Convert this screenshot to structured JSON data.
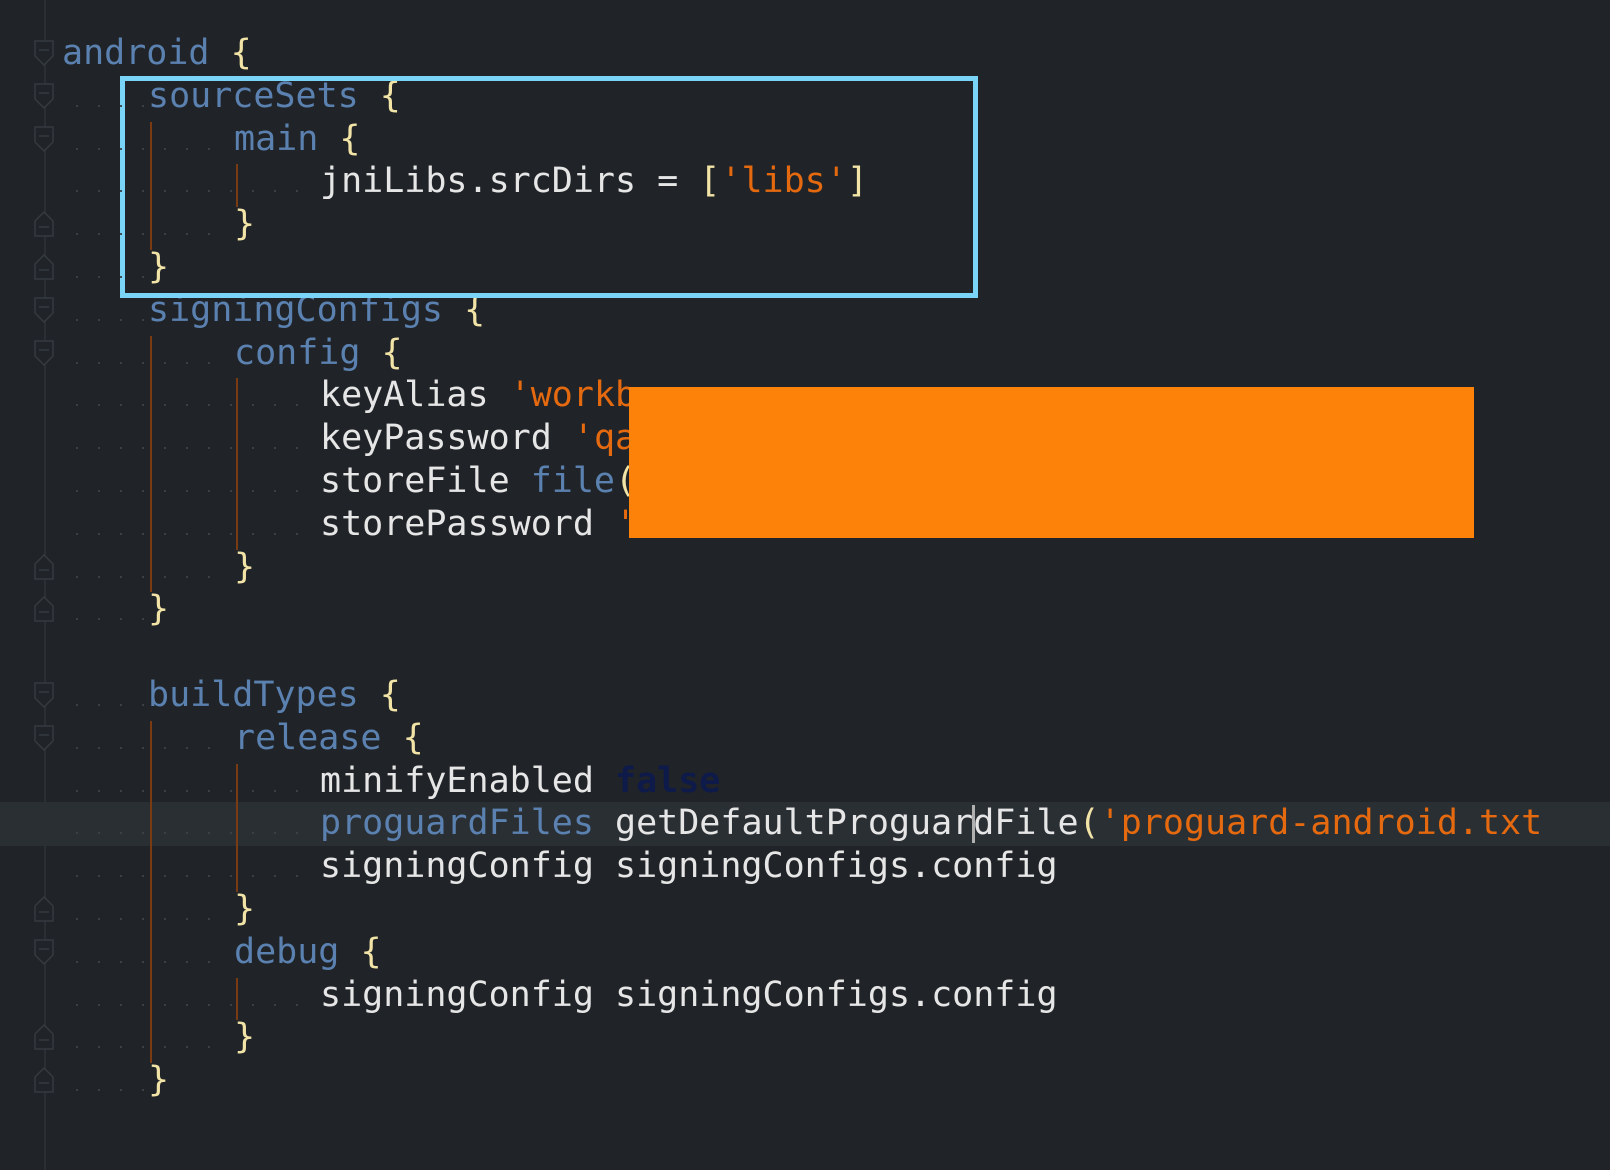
{
  "editor": {
    "lines": [
      {
        "tokens": [
          {
            "t": "android",
            "c": "kw"
          },
          {
            "t": " ",
            "c": "plain"
          },
          {
            "t": "{",
            "c": "br"
          }
        ]
      },
      {
        "tokens": [
          {
            "t": "sourceSets",
            "c": "kw"
          },
          {
            "t": " ",
            "c": "plain"
          },
          {
            "t": "{",
            "c": "br"
          }
        ]
      },
      {
        "tokens": [
          {
            "t": "main",
            "c": "kw"
          },
          {
            "t": " ",
            "c": "plain"
          },
          {
            "t": "{",
            "c": "br"
          }
        ]
      },
      {
        "tokens": [
          {
            "t": "jniLibs.srcDirs = ",
            "c": "plain"
          },
          {
            "t": "[",
            "c": "br"
          },
          {
            "t": "'libs'",
            "c": "str"
          },
          {
            "t": "]",
            "c": "br"
          }
        ]
      },
      {
        "tokens": [
          {
            "t": "}",
            "c": "br"
          }
        ]
      },
      {
        "tokens": [
          {
            "t": "}",
            "c": "br"
          }
        ]
      },
      {
        "tokens": [
          {
            "t": "signingConfigs",
            "c": "kw"
          },
          {
            "t": " ",
            "c": "plain"
          },
          {
            "t": "{",
            "c": "br"
          }
        ]
      },
      {
        "tokens": [
          {
            "t": "config",
            "c": "kw"
          },
          {
            "t": " ",
            "c": "plain"
          },
          {
            "t": "{",
            "c": "br"
          }
        ]
      },
      {
        "tokens": [
          {
            "t": "keyAlias ",
            "c": "plain"
          },
          {
            "t": "'workb",
            "c": "str"
          }
        ]
      },
      {
        "tokens": [
          {
            "t": "keyPassword ",
            "c": "plain"
          },
          {
            "t": "'qa",
            "c": "str"
          }
        ]
      },
      {
        "tokens": [
          {
            "t": "storeFile ",
            "c": "plain"
          },
          {
            "t": "file",
            "c": "kw"
          },
          {
            "t": "(",
            "c": "br"
          }
        ]
      },
      {
        "tokens": [
          {
            "t": "storePassword ",
            "c": "plain"
          },
          {
            "t": "'",
            "c": "str"
          }
        ]
      },
      {
        "tokens": [
          {
            "t": "}",
            "c": "br"
          }
        ]
      },
      {
        "tokens": [
          {
            "t": "}",
            "c": "br"
          }
        ]
      },
      {
        "tokens": []
      },
      {
        "tokens": [
          {
            "t": "buildTypes",
            "c": "kw"
          },
          {
            "t": " ",
            "c": "plain"
          },
          {
            "t": "{",
            "c": "br"
          }
        ]
      },
      {
        "tokens": [
          {
            "t": "release",
            "c": "kw"
          },
          {
            "t": " ",
            "c": "plain"
          },
          {
            "t": "{",
            "c": "br"
          }
        ]
      },
      {
        "tokens": [
          {
            "t": "minifyEnabled ",
            "c": "plain"
          },
          {
            "t": "false",
            "c": "fals"
          }
        ]
      },
      {
        "tokens": [
          {
            "t": "proguardFiles",
            "c": "kw"
          },
          {
            "t": " getDefaultProguar",
            "c": "plain"
          },
          {
            "t": "|",
            "c": "caret"
          },
          {
            "t": "dFile",
            "c": "plain"
          },
          {
            "t": "(",
            "c": "br"
          },
          {
            "t": "'proguard-android.txt",
            "c": "str"
          }
        ]
      },
      {
        "tokens": [
          {
            "t": "signingConfig signingConfigs.config",
            "c": "plain"
          }
        ]
      },
      {
        "tokens": [
          {
            "t": "}",
            "c": "br"
          }
        ]
      },
      {
        "tokens": [
          {
            "t": "debug",
            "c": "kw"
          },
          {
            "t": " ",
            "c": "plain"
          },
          {
            "t": "{",
            "c": "br"
          }
        ]
      },
      {
        "tokens": [
          {
            "t": "signingConfig signingConfigs.config",
            "c": "plain"
          }
        ]
      },
      {
        "tokens": [
          {
            "t": "}",
            "c": "br"
          }
        ]
      },
      {
        "tokens": [
          {
            "t": "}",
            "c": "br"
          }
        ]
      }
    ],
    "indents": [
      0,
      1,
      2,
      3,
      2,
      1,
      1,
      2,
      3,
      3,
      3,
      3,
      2,
      1,
      0,
      1,
      2,
      3,
      3,
      3,
      2,
      2,
      3,
      2,
      1
    ],
    "current_line": 18,
    "annotations": {
      "highlight_box_color": "#79d4f7",
      "redaction_color": "#fc820a"
    }
  }
}
